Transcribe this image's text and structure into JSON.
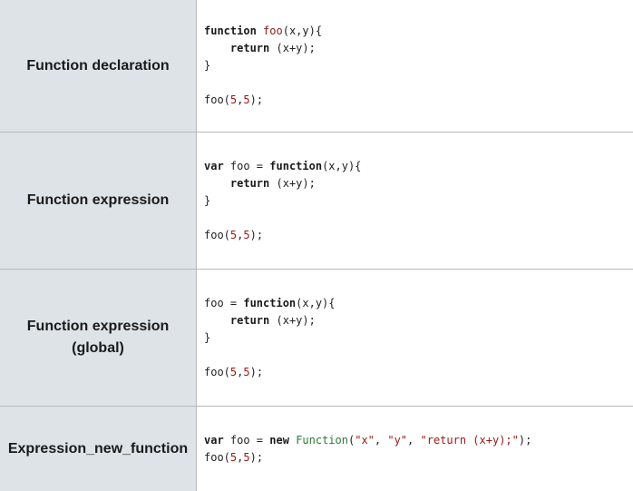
{
  "rows": [
    {
      "label_lines": [
        "Function declaration"
      ],
      "code_lines": [
        [
          "function",
          " ",
          "foo",
          "(x,y){"
        ],
        [
          "    ",
          "return",
          " (x+y);"
        ],
        [
          "}"
        ],
        [
          ""
        ],
        [
          "foo(",
          "5",
          ",",
          "5",
          ");"
        ]
      ]
    },
    {
      "label_lines": [
        "Function expression"
      ],
      "code_lines": [
        [
          "var",
          " foo = ",
          "function",
          "(x,y){"
        ],
        [
          "    ",
          "return",
          " (x+y);"
        ],
        [
          "}"
        ],
        [
          ""
        ],
        [
          "foo(",
          "5",
          ",",
          "5",
          ");"
        ]
      ]
    },
    {
      "label_lines": [
        "Function expression",
        "(global)"
      ],
      "code_lines": [
        [
          "foo = ",
          "function",
          "(x,y){"
        ],
        [
          "    ",
          "return",
          " (x+y);"
        ],
        [
          "}"
        ],
        [
          ""
        ],
        [
          "foo(",
          "5",
          ",",
          "5",
          ");"
        ]
      ]
    },
    {
      "label_lines": [
        "Expression_new_function"
      ],
      "code_lines": [
        [
          "var",
          " foo = ",
          "new",
          " ",
          "Function",
          "(",
          "\"x\"",
          ", ",
          "\"y\"",
          ", ",
          "\"return (x+y);\"",
          ");"
        ],
        [
          "foo(",
          "5",
          ",",
          "5",
          ");"
        ]
      ]
    }
  ]
}
